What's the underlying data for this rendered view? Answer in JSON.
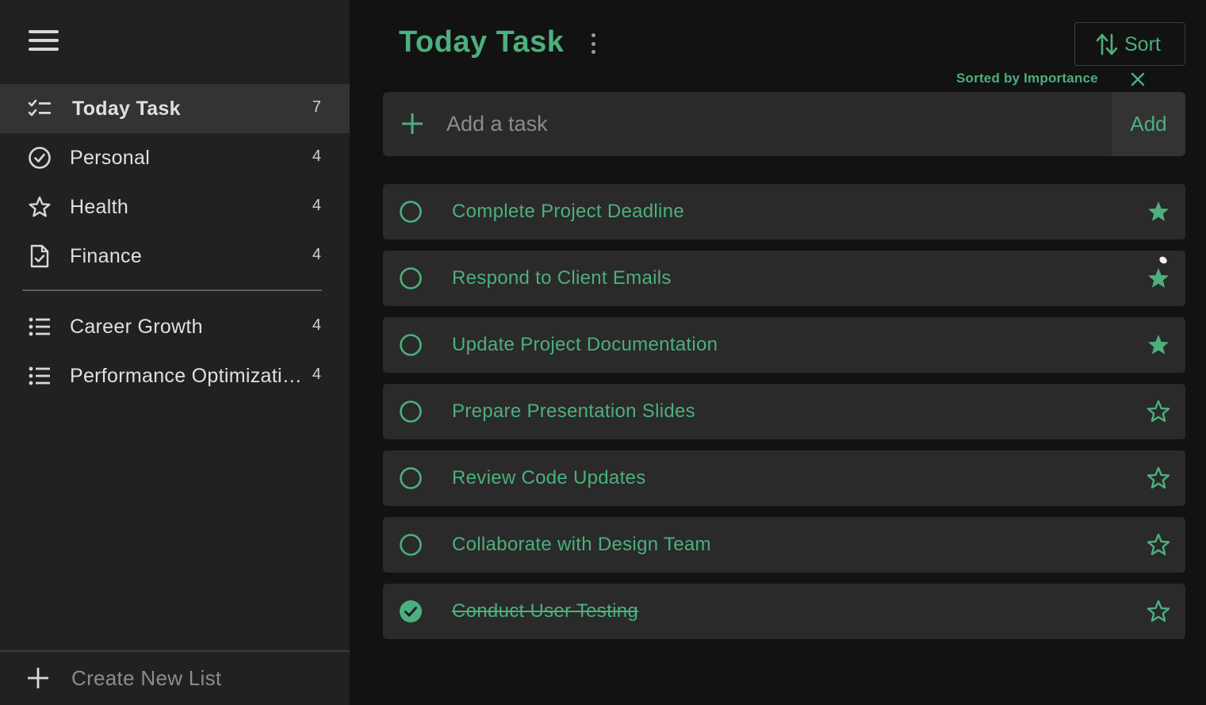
{
  "sidebar": {
    "items": [
      {
        "label": "Today Task",
        "count": "7",
        "icon": "checklist-icon"
      },
      {
        "label": "Personal",
        "count": "4",
        "icon": "check-circle-icon"
      },
      {
        "label": "Health",
        "count": "4",
        "icon": "star-icon"
      },
      {
        "label": "Finance",
        "count": "4",
        "icon": "document-check-icon"
      }
    ],
    "custom_lists": [
      {
        "label": "Career Growth",
        "count": "4",
        "icon": "list-icon"
      },
      {
        "label": "Performance Optimization",
        "count": "4",
        "icon": "list-icon"
      }
    ],
    "create_label": "Create New List"
  },
  "main": {
    "title": "Today Task",
    "sort_label": "Sort",
    "sorted_by": "Sorted by Importance",
    "add_placeholder": "Add a task",
    "add_button": "Add",
    "tasks": [
      {
        "title": "Complete Project Deadline",
        "completed": false,
        "important": true
      },
      {
        "title": "Respond to Client Emails",
        "completed": false,
        "important": true
      },
      {
        "title": "Update Project Documentation",
        "completed": false,
        "important": true
      },
      {
        "title": "Prepare Presentation Slides",
        "completed": false,
        "important": false
      },
      {
        "title": "Review Code Updates",
        "completed": false,
        "important": false
      },
      {
        "title": "Collaborate with Design Team",
        "completed": false,
        "important": false
      },
      {
        "title": "Conduct User Testing",
        "completed": true,
        "important": false
      }
    ]
  },
  "colors": {
    "accent": "#4caf7d",
    "sidebar_bg": "#212121",
    "main_bg": "#121212",
    "card_bg": "#2a2a2a"
  }
}
